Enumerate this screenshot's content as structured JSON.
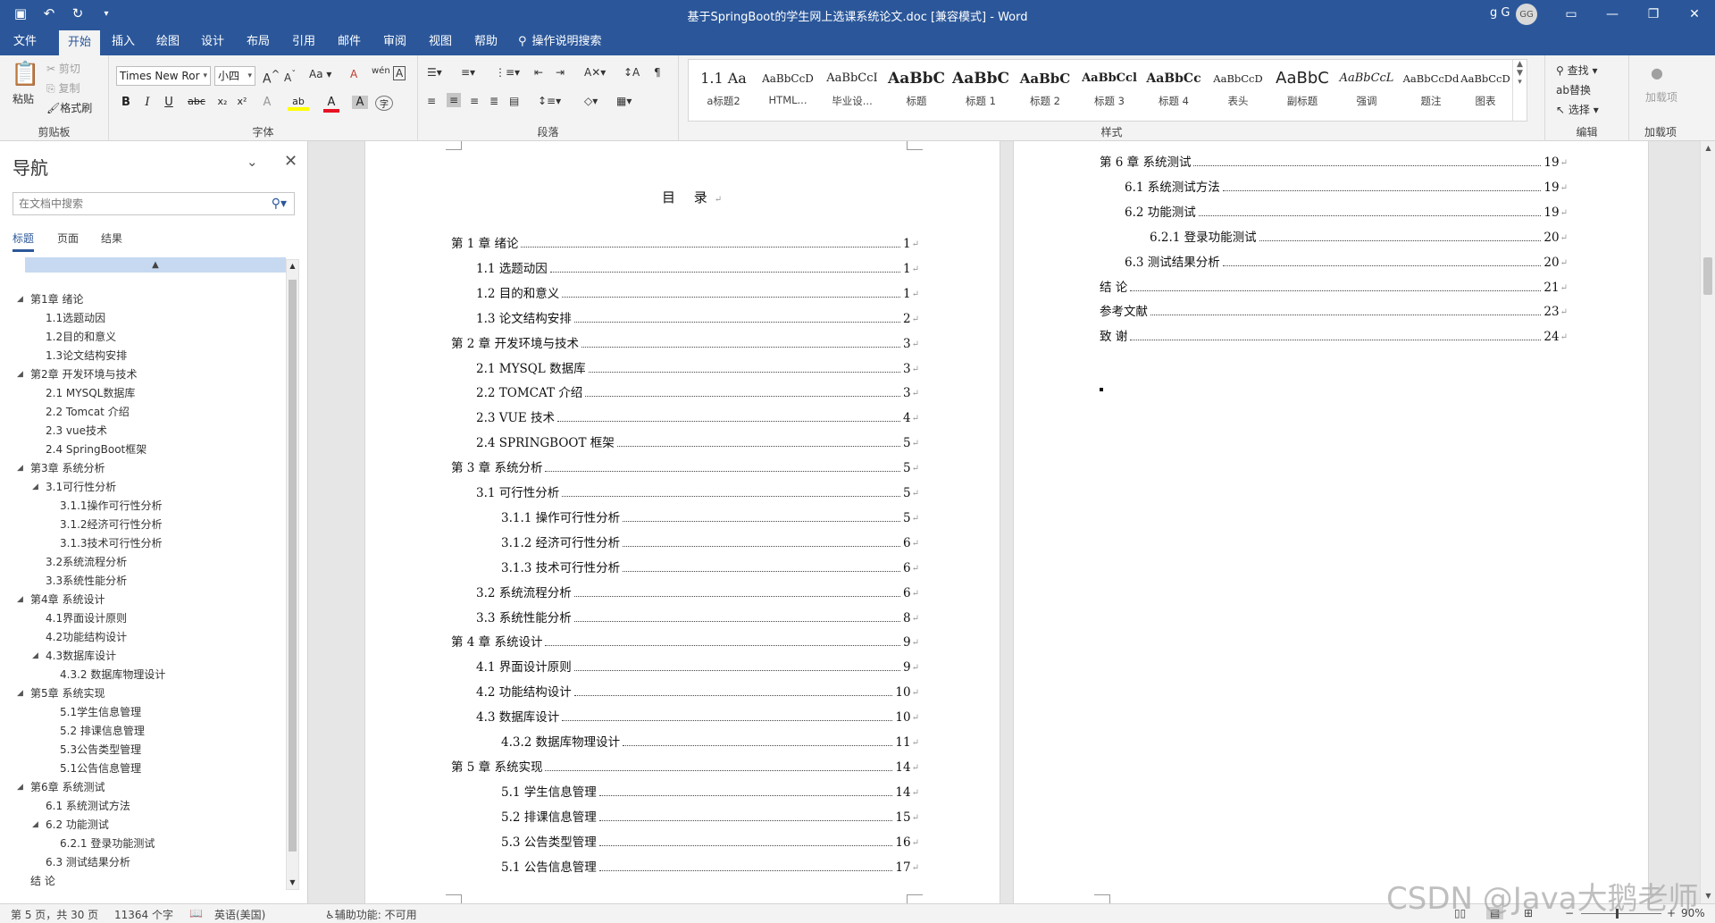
{
  "app": {
    "title": "基于SpringBoot的学生网上选课系统论文.doc [兼容模式]  -  Word",
    "user_name": "g G",
    "avatar_initials": "GG",
    "quick_access": [
      "save-icon",
      "undo-icon",
      "redo-icon",
      "customize-icon"
    ],
    "window_buttons": [
      "ribbon-display-icon",
      "minimize-icon",
      "restore-icon",
      "close-icon"
    ]
  },
  "menu": {
    "tabs": [
      "文件",
      "开始",
      "插入",
      "绘图",
      "设计",
      "布局",
      "引用",
      "邮件",
      "审阅",
      "视图",
      "帮助"
    ],
    "active_tab": "开始",
    "tell_me": "操作说明搜索"
  },
  "ribbon": {
    "clipboard": {
      "label": "剪贴板",
      "paste": "粘贴",
      "cut": "剪切",
      "copy": "复制",
      "format_painter": "格式刷"
    },
    "font": {
      "label": "字体",
      "font_name": "Times New Ror",
      "font_size": "小四",
      "bold": "B",
      "italic": "I",
      "underline": "U",
      "strike": "abc",
      "subscript": "x₂",
      "superscript": "x²",
      "grow": "A",
      "shrink": "A",
      "case": "Aa",
      "clear": "A",
      "pinyin": "wén",
      "border": "A",
      "effects": "A",
      "highlight": "ab",
      "color": "A",
      "shading": "A",
      "enclose": "字",
      "font_color_hex": "#e81123",
      "highlight_hex": "#ffff00"
    },
    "paragraph": {
      "label": "段落"
    },
    "styles": {
      "label": "样式",
      "items": [
        {
          "preview": "1.1  Aa",
          "name": "a标题2"
        },
        {
          "preview": "AaBbCcD",
          "name": "HTML..."
        },
        {
          "preview": "AaBbCcI",
          "name": "毕业设..."
        },
        {
          "preview": "AaBbC",
          "name": "标题"
        },
        {
          "preview": "AaBbC",
          "name": "标题 1"
        },
        {
          "preview": "AaBbC",
          "name": "标题 2"
        },
        {
          "preview": "AaBbCcl",
          "name": "标题 3"
        },
        {
          "preview": "AaBbCc",
          "name": "标题 4"
        },
        {
          "preview": "AaBbCcD",
          "name": "表头"
        },
        {
          "preview": "AaBbC",
          "name": "副标题"
        },
        {
          "preview": "AaBbCcL",
          "name": "强调"
        },
        {
          "preview": "AaBbCcDd",
          "name": "题注"
        },
        {
          "preview": "AaBbCcD",
          "name": "图表"
        }
      ]
    },
    "editing": {
      "label": "编辑",
      "find": "查找",
      "replace": "替换",
      "select": "选择"
    },
    "addins": {
      "label": "加载项",
      "button": "加载项"
    }
  },
  "nav": {
    "title": "导航",
    "search_placeholder": "在文档中搜索",
    "tabs": [
      "标题",
      "页面",
      "结果"
    ],
    "active_tab": "标题",
    "items": [
      {
        "text": "第1章 绪论",
        "level": 1,
        "expanded": true
      },
      {
        "text": "1.1选题动因",
        "level": 2
      },
      {
        "text": "1.2目的和意义",
        "level": 2
      },
      {
        "text": "1.3论文结构安排",
        "level": 2
      },
      {
        "text": "第2章 开发环境与技术",
        "level": 1,
        "expanded": true
      },
      {
        "text": "2.1 MYSQL数据库",
        "level": 2
      },
      {
        "text": "2.2 Tomcat 介绍",
        "level": 2
      },
      {
        "text": "2.3 vue技术",
        "level": 2
      },
      {
        "text": "2.4 SpringBoot框架",
        "level": 2
      },
      {
        "text": "第3章 系统分析",
        "level": 1,
        "expanded": true
      },
      {
        "text": "3.1可行性分析",
        "level": 2,
        "expanded": true
      },
      {
        "text": "3.1.1操作可行性分析",
        "level": 3
      },
      {
        "text": "3.1.2经济可行性分析",
        "level": 3
      },
      {
        "text": "3.1.3技术可行性分析",
        "level": 3
      },
      {
        "text": "3.2系统流程分析",
        "level": 2
      },
      {
        "text": "3.3系统性能分析",
        "level": 2
      },
      {
        "text": "第4章 系统设计",
        "level": 1,
        "expanded": true
      },
      {
        "text": "4.1界面设计原则",
        "level": 2
      },
      {
        "text": "4.2功能结构设计",
        "level": 2
      },
      {
        "text": "4.3数据库设计",
        "level": 2,
        "expanded": true
      },
      {
        "text": "4.3.2 数据库物理设计",
        "level": 3
      },
      {
        "text": "第5章 系统实现",
        "level": 1,
        "expanded": true
      },
      {
        "text": "5.1学生信息管理",
        "level": 3
      },
      {
        "text": "5.2 排课信息管理",
        "level": 3
      },
      {
        "text": "5.3公告类型管理",
        "level": 3
      },
      {
        "text": "5.1公告信息管理",
        "level": 3
      },
      {
        "text": "第6章 系统测试",
        "level": 1,
        "expanded": true
      },
      {
        "text": "6.1 系统测试方法",
        "level": 2
      },
      {
        "text": "6.2 功能测试",
        "level": 2,
        "expanded": true
      },
      {
        "text": "6.2.1 登录功能测试",
        "level": 3
      },
      {
        "text": "6.3 测试结果分析",
        "level": 2
      },
      {
        "text": "结  论",
        "level": 1
      }
    ]
  },
  "page_left": {
    "title": "目 录",
    "entries": [
      {
        "text": "第 1 章  绪论",
        "page": "1",
        "level": 1
      },
      {
        "text": "1.1 选题动因",
        "page": "1",
        "level": 2
      },
      {
        "text": "1.2 目的和意义",
        "page": "1",
        "level": 2
      },
      {
        "text": "1.3 论文结构安排",
        "page": "2",
        "level": 2
      },
      {
        "text": "第 2 章  开发环境与技术",
        "page": "3",
        "level": 1
      },
      {
        "text": "2.1 MYSQL 数据库",
        "page": "3",
        "level": 2
      },
      {
        "text": "2.2 TOMCAT 介绍",
        "page": "3",
        "level": 2
      },
      {
        "text": "2.3 VUE 技术",
        "page": "4",
        "level": 2
      },
      {
        "text": "2.4 SPRINGBOOT 框架",
        "page": "5",
        "level": 2
      },
      {
        "text": "第 3 章  系统分析",
        "page": "5",
        "level": 1
      },
      {
        "text": "3.1 可行性分析",
        "page": "5",
        "level": 2
      },
      {
        "text": "3.1.1 操作可行性分析",
        "page": "5",
        "level": 3
      },
      {
        "text": "3.1.2 经济可行性分析",
        "page": "6",
        "level": 3
      },
      {
        "text": "3.1.3 技术可行性分析",
        "page": "6",
        "level": 3
      },
      {
        "text": "3.2 系统流程分析",
        "page": "6",
        "level": 2
      },
      {
        "text": "3.3 系统性能分析",
        "page": "8",
        "level": 2
      },
      {
        "text": "第 4 章  系统设计",
        "page": "9",
        "level": 1
      },
      {
        "text": "4.1 界面设计原则",
        "page": "9",
        "level": 2
      },
      {
        "text": "4.2 功能结构设计",
        "page": "10",
        "level": 2
      },
      {
        "text": "4.3 数据库设计",
        "page": "10",
        "level": 2
      },
      {
        "text": "4.3.2  数据库物理设计",
        "page": "11",
        "level": 3
      },
      {
        "text": "第 5 章  系统实现",
        "page": "14",
        "level": 1
      },
      {
        "text": "5.1 学生信息管理",
        "page": "14",
        "level": 3
      },
      {
        "text": "5.2  排课信息管理",
        "page": "15",
        "level": 3
      },
      {
        "text": "5.3 公告类型管理",
        "page": "16",
        "level": 3
      },
      {
        "text": "5.1 公告信息管理",
        "page": "17",
        "level": 3
      }
    ]
  },
  "page_right": {
    "entries": [
      {
        "text": "第 6 章  系统测试",
        "page": "19",
        "level": 1
      },
      {
        "text": "6.1  系统测试方法",
        "page": "19",
        "level": 2
      },
      {
        "text": "6.2  功能测试",
        "page": "19",
        "level": 2
      },
      {
        "text": "6.2.1  登录功能测试",
        "page": "20",
        "level": 3
      },
      {
        "text": "6.3  测试结果分析",
        "page": "20",
        "level": 2
      },
      {
        "text": "结    论",
        "page": "21",
        "level": 1
      },
      {
        "text": "参考文献",
        "page": "23",
        "level": 1
      },
      {
        "text": "致    谢",
        "page": "24",
        "level": 1
      }
    ]
  },
  "status": {
    "page": "第 5 页，共 30 页",
    "words": "11364 个字",
    "language": "英语(美国)",
    "accessibility": "辅助功能: 不可用",
    "zoom": "90%",
    "zoom_level": 0.9
  },
  "watermark": "CSDN @Java大鹅老师",
  "colors": {
    "brand": "#2b579a",
    "ribbon_bg": "#f3f3f3",
    "canvas_bg": "#e6e6e6"
  }
}
